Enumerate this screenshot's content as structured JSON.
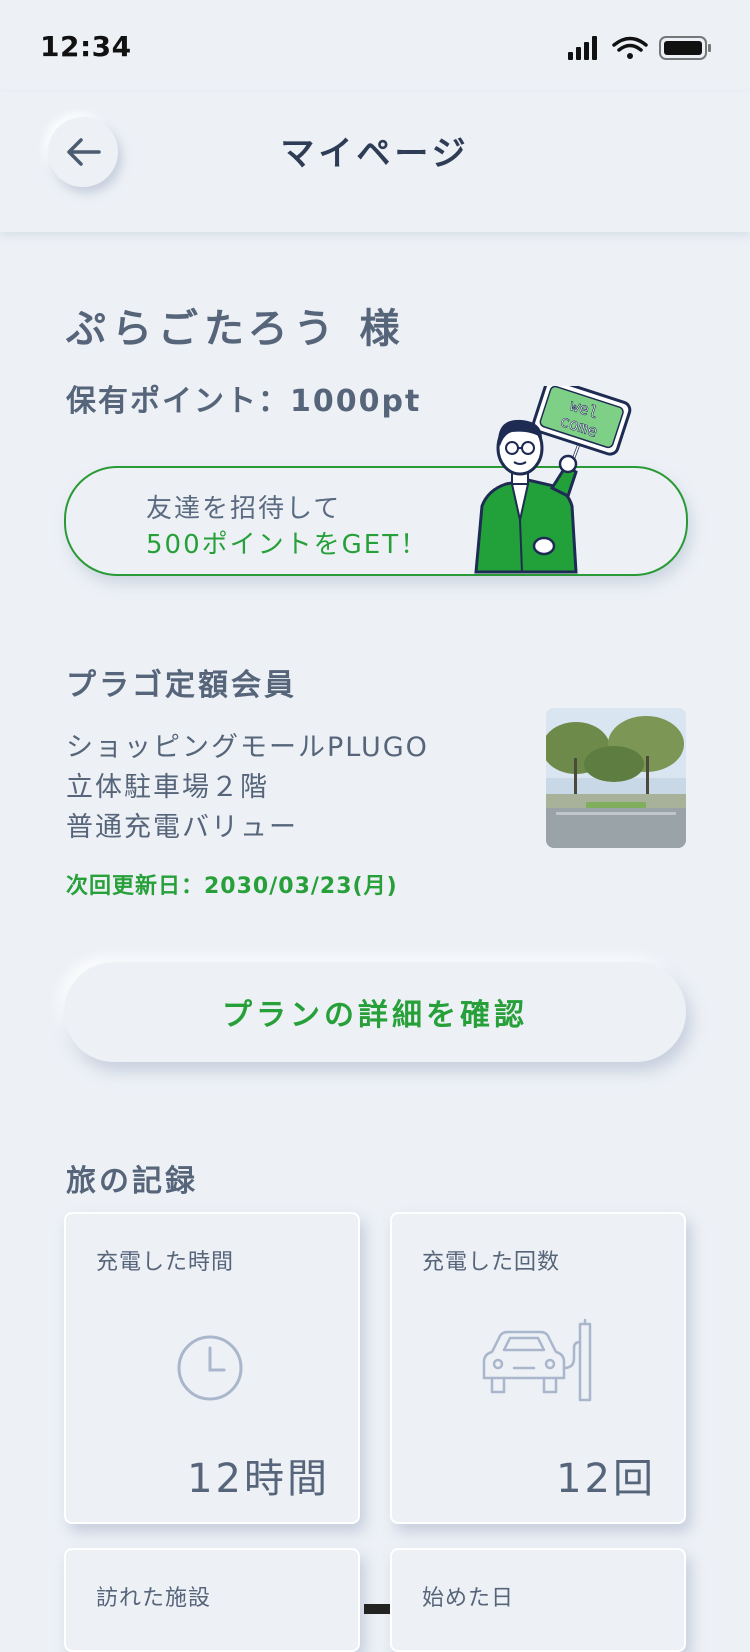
{
  "status_bar": {
    "time": "12:34"
  },
  "header": {
    "title": "マイページ"
  },
  "user": {
    "name": "ぷらごたろう 様",
    "points": "保有ポイント：1000pt"
  },
  "invite": {
    "line1": "友達を招待して",
    "line2": "500ポイントをGET！",
    "sign_line1": "wel",
    "sign_line2": "come"
  },
  "plan": {
    "title": "プラゴ定額会員",
    "facility_line1": "ショッピングモールPLUGO",
    "facility_line2": "立体駐車場２階",
    "facility_line3": "普通充電バリュー",
    "renewal": "次回更新日：2030/03/23(月)",
    "details_button": "プランの詳細を確認"
  },
  "records": {
    "title": "旅の記録",
    "cards": [
      {
        "label": "充電した時間",
        "value": "12時間",
        "icon": "clock-icon"
      },
      {
        "label": "充電した回数",
        "value": "12回",
        "icon": "car-charging-icon"
      },
      {
        "label": "訪れた施設",
        "value": ""
      },
      {
        "label": "始めた日",
        "value": ""
      }
    ]
  },
  "colors": {
    "accent_green": "#27a03a",
    "background": "#edf1f6",
    "text": "#56657a",
    "icon": "#a9b6cb"
  }
}
